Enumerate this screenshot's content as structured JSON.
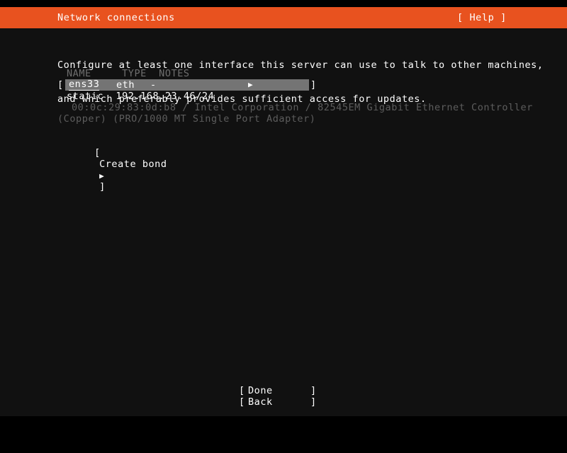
{
  "header": {
    "title": "Network connections",
    "help_label": "[ Help ]",
    "bg_color": "#e8521f",
    "fg_color": "#ffffff"
  },
  "intro": {
    "line1": "Configure at least one interface this server can use to talk to other machines,",
    "line2": "and which preferably provides sufficient access for updates."
  },
  "table": {
    "columns_line": "NAME     TYPE  NOTES",
    "columns": [
      "NAME",
      "TYPE",
      "NOTES"
    ],
    "rows": [
      {
        "bracket_open": "[",
        "bracket_close": "]",
        "name": "ens33",
        "type": "eth",
        "notes": "-",
        "arrow": "▶",
        "selected": true,
        "detail_address_label": "static",
        "detail_address": "192.168.23.46/24",
        "detail_line": "static  192.168.23.46/24",
        "hw_line1": "00:0c:29:83:0d:b8 / Intel Corporation / 82545EM Gigabit Ethernet Controller",
        "hw_line2": "(Copper) (PRO/1000 MT Single Port Adapter)",
        "mac": "00:0c:29:83:0d:b8",
        "vendor": "Intel Corporation",
        "model": "82545EM Gigabit Ethernet Controller (Copper) (PRO/1000 MT Single Port Adapter)"
      }
    ]
  },
  "create_bond": {
    "bracket_open": "[",
    "label": "Create bond",
    "arrow": "▶",
    "bracket_close": "]",
    "full": "[ Create bond ▶ ]"
  },
  "footer": {
    "buttons": [
      {
        "bracket_open": "[",
        "label": "Done",
        "bracket_close": "]"
      },
      {
        "bracket_open": "[",
        "label": "Back",
        "bracket_close": "]"
      }
    ]
  },
  "colors": {
    "background": "#111111",
    "letterbox": "#000000",
    "accent": "#e8521f",
    "text": "#ffffff",
    "dim_text": "#5d5d5d",
    "column_header": "#6e6e6e",
    "selection": "#747474"
  }
}
